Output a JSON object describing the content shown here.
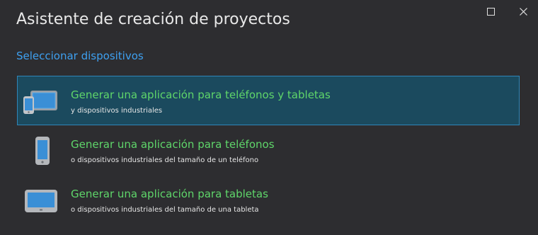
{
  "window": {
    "title": "Asistente de creación de proyectos",
    "maximize_icon": "maximize-icon",
    "close_icon": "close-icon"
  },
  "section": {
    "label": "Seleccionar dispositivos"
  },
  "options": [
    {
      "title": "Generar una aplicación para teléfonos y tabletas",
      "subtitle": "y dispositivos industriales",
      "icon": "phone-and-tablet-icon",
      "selected": true
    },
    {
      "title": "Generar una aplicación para teléfonos",
      "subtitle": "o dispositivos industriales del tamaño de un teléfono",
      "icon": "phone-icon",
      "selected": false
    },
    {
      "title": "Generar una aplicación para tabletas",
      "subtitle": "o dispositivos industriales del tamaño de una tableta",
      "icon": "tablet-icon",
      "selected": false
    }
  ],
  "colors": {
    "background": "#2d2d30",
    "accent_link": "#3ea0f0",
    "option_title": "#5fd66a",
    "selected_background": "#1b4a5e",
    "selected_border": "#2f86b8"
  }
}
